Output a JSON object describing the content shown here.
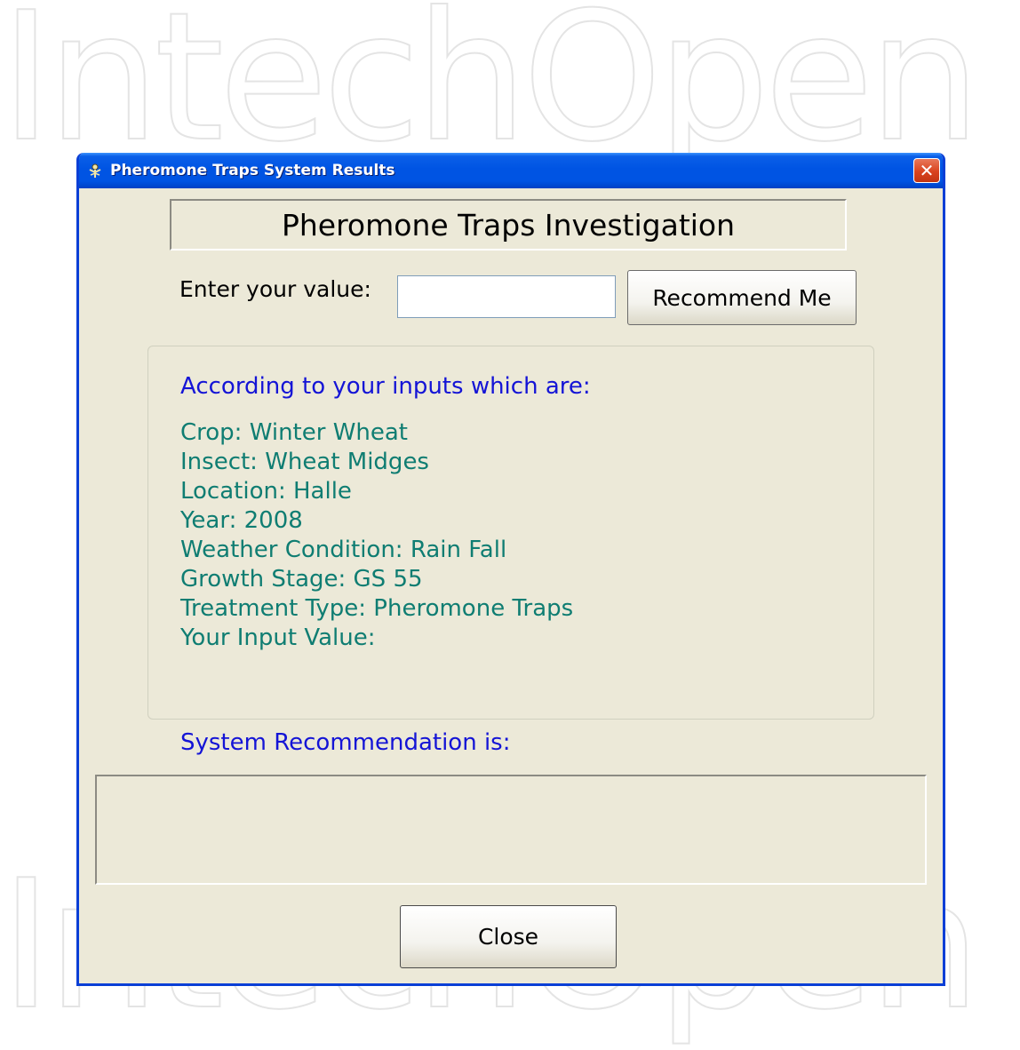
{
  "watermark": {
    "logo_text": "IntechOpen"
  },
  "window": {
    "title": "Pheromone Traps System Results",
    "close_glyph": "✕",
    "icon": "app-icon"
  },
  "form": {
    "heading": "Pheromone Traps Investigation",
    "input_label": "Enter your value:",
    "input_value": "",
    "recommend_button": "Recommend Me"
  },
  "inputs_summary": {
    "intro": "According to your inputs which are:",
    "lines": [
      "Crop: Winter Wheat",
      "Insect: Wheat Midges",
      "Location: Halle",
      "Year: 2008",
      "Weather Condition: Rain Fall",
      "Growth Stage: GS 55",
      "Treatment Type: Pheromone Traps",
      "Your Input Value:"
    ]
  },
  "recommendation": {
    "label": "System Recommendation is:",
    "output": ""
  },
  "footer": {
    "close_button": "Close"
  },
  "colors": {
    "title_bar": "#0054e3",
    "window_bg": "#ece9d8",
    "intro_text": "#1414d6",
    "info_text": "#0f7d72",
    "close_x_bg": "#d9431f"
  }
}
